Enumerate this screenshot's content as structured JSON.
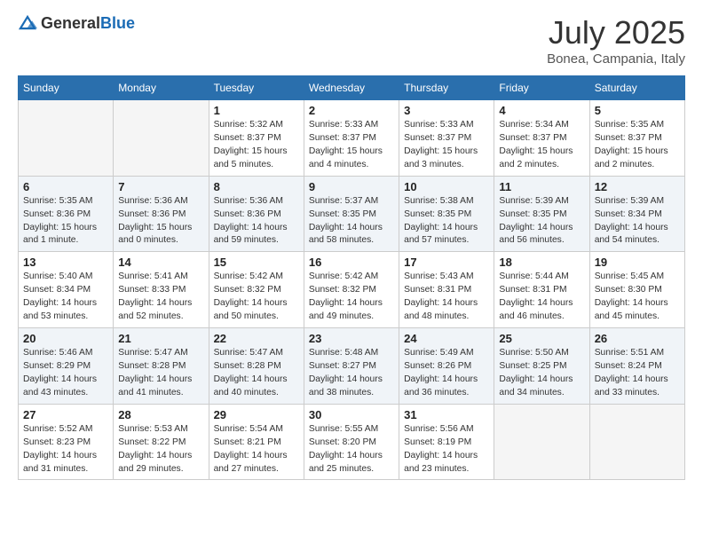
{
  "header": {
    "logo_general": "General",
    "logo_blue": "Blue",
    "month": "July 2025",
    "location": "Bonea, Campania, Italy"
  },
  "weekdays": [
    "Sunday",
    "Monday",
    "Tuesday",
    "Wednesday",
    "Thursday",
    "Friday",
    "Saturday"
  ],
  "weeks": [
    [
      {
        "day": "",
        "empty": true
      },
      {
        "day": "",
        "empty": true
      },
      {
        "day": "1",
        "sunrise": "5:32 AM",
        "sunset": "8:37 PM",
        "daylight": "15 hours and 5 minutes."
      },
      {
        "day": "2",
        "sunrise": "5:33 AM",
        "sunset": "8:37 PM",
        "daylight": "15 hours and 4 minutes."
      },
      {
        "day": "3",
        "sunrise": "5:33 AM",
        "sunset": "8:37 PM",
        "daylight": "15 hours and 3 minutes."
      },
      {
        "day": "4",
        "sunrise": "5:34 AM",
        "sunset": "8:37 PM",
        "daylight": "15 hours and 2 minutes."
      },
      {
        "day": "5",
        "sunrise": "5:35 AM",
        "sunset": "8:37 PM",
        "daylight": "15 hours and 2 minutes."
      }
    ],
    [
      {
        "day": "6",
        "sunrise": "5:35 AM",
        "sunset": "8:36 PM",
        "daylight": "15 hours and 1 minute."
      },
      {
        "day": "7",
        "sunrise": "5:36 AM",
        "sunset": "8:36 PM",
        "daylight": "15 hours and 0 minutes."
      },
      {
        "day": "8",
        "sunrise": "5:36 AM",
        "sunset": "8:36 PM",
        "daylight": "14 hours and 59 minutes."
      },
      {
        "day": "9",
        "sunrise": "5:37 AM",
        "sunset": "8:35 PM",
        "daylight": "14 hours and 58 minutes."
      },
      {
        "day": "10",
        "sunrise": "5:38 AM",
        "sunset": "8:35 PM",
        "daylight": "14 hours and 57 minutes."
      },
      {
        "day": "11",
        "sunrise": "5:39 AM",
        "sunset": "8:35 PM",
        "daylight": "14 hours and 56 minutes."
      },
      {
        "day": "12",
        "sunrise": "5:39 AM",
        "sunset": "8:34 PM",
        "daylight": "14 hours and 54 minutes."
      }
    ],
    [
      {
        "day": "13",
        "sunrise": "5:40 AM",
        "sunset": "8:34 PM",
        "daylight": "14 hours and 53 minutes."
      },
      {
        "day": "14",
        "sunrise": "5:41 AM",
        "sunset": "8:33 PM",
        "daylight": "14 hours and 52 minutes."
      },
      {
        "day": "15",
        "sunrise": "5:42 AM",
        "sunset": "8:32 PM",
        "daylight": "14 hours and 50 minutes."
      },
      {
        "day": "16",
        "sunrise": "5:42 AM",
        "sunset": "8:32 PM",
        "daylight": "14 hours and 49 minutes."
      },
      {
        "day": "17",
        "sunrise": "5:43 AM",
        "sunset": "8:31 PM",
        "daylight": "14 hours and 48 minutes."
      },
      {
        "day": "18",
        "sunrise": "5:44 AM",
        "sunset": "8:31 PM",
        "daylight": "14 hours and 46 minutes."
      },
      {
        "day": "19",
        "sunrise": "5:45 AM",
        "sunset": "8:30 PM",
        "daylight": "14 hours and 45 minutes."
      }
    ],
    [
      {
        "day": "20",
        "sunrise": "5:46 AM",
        "sunset": "8:29 PM",
        "daylight": "14 hours and 43 minutes."
      },
      {
        "day": "21",
        "sunrise": "5:47 AM",
        "sunset": "8:28 PM",
        "daylight": "14 hours and 41 minutes."
      },
      {
        "day": "22",
        "sunrise": "5:47 AM",
        "sunset": "8:28 PM",
        "daylight": "14 hours and 40 minutes."
      },
      {
        "day": "23",
        "sunrise": "5:48 AM",
        "sunset": "8:27 PM",
        "daylight": "14 hours and 38 minutes."
      },
      {
        "day": "24",
        "sunrise": "5:49 AM",
        "sunset": "8:26 PM",
        "daylight": "14 hours and 36 minutes."
      },
      {
        "day": "25",
        "sunrise": "5:50 AM",
        "sunset": "8:25 PM",
        "daylight": "14 hours and 34 minutes."
      },
      {
        "day": "26",
        "sunrise": "5:51 AM",
        "sunset": "8:24 PM",
        "daylight": "14 hours and 33 minutes."
      }
    ],
    [
      {
        "day": "27",
        "sunrise": "5:52 AM",
        "sunset": "8:23 PM",
        "daylight": "14 hours and 31 minutes."
      },
      {
        "day": "28",
        "sunrise": "5:53 AM",
        "sunset": "8:22 PM",
        "daylight": "14 hours and 29 minutes."
      },
      {
        "day": "29",
        "sunrise": "5:54 AM",
        "sunset": "8:21 PM",
        "daylight": "14 hours and 27 minutes."
      },
      {
        "day": "30",
        "sunrise": "5:55 AM",
        "sunset": "8:20 PM",
        "daylight": "14 hours and 25 minutes."
      },
      {
        "day": "31",
        "sunrise": "5:56 AM",
        "sunset": "8:19 PM",
        "daylight": "14 hours and 23 minutes."
      },
      {
        "day": "",
        "empty": true
      },
      {
        "day": "",
        "empty": true
      }
    ]
  ]
}
